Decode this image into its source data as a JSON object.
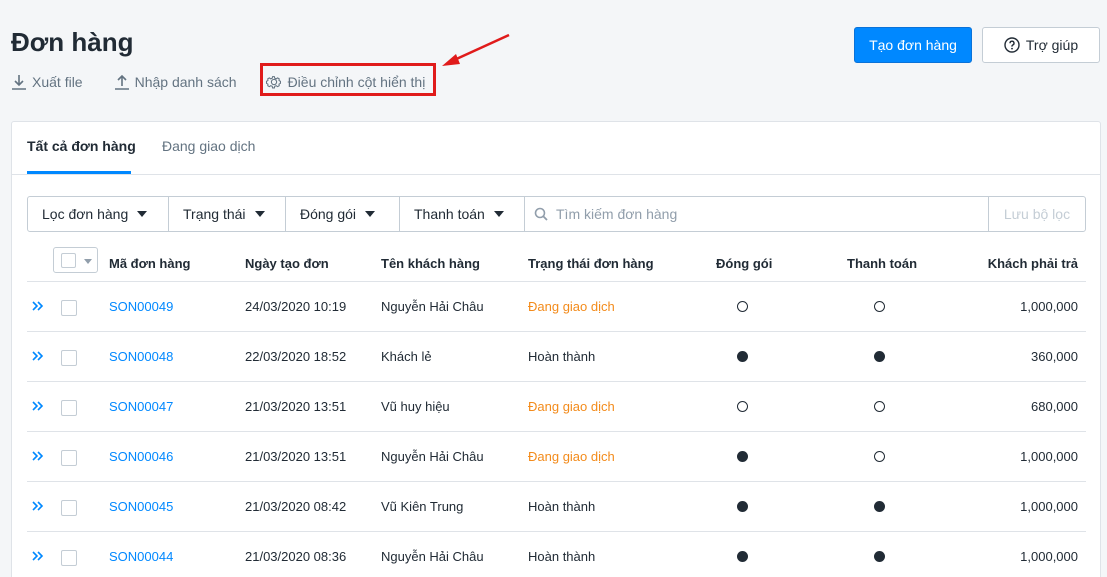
{
  "header": {
    "title": "Đơn hàng",
    "export_label": "Xuất file",
    "import_label": "Nhập danh sách",
    "columns_label": "Điều chỉnh cột hiển thị",
    "create_button": "Tạo đơn hàng",
    "help_button": "Trợ giúp"
  },
  "tabs": [
    {
      "label": "Tất cả đơn hàng",
      "active": true
    },
    {
      "label": "Đang giao dịch",
      "active": false
    }
  ],
  "filters": {
    "items": [
      "Lọc đơn hàng",
      "Trạng thái",
      "Đóng gói",
      "Thanh toán"
    ],
    "search_placeholder": "Tìm kiếm đơn hàng",
    "save_label": "Lưu bộ lọc"
  },
  "table": {
    "headers": {
      "code": "Mã đơn hàng",
      "date": "Ngày tạo đơn",
      "customer": "Tên khách hàng",
      "status": "Trạng thái đơn hàng",
      "packing": "Đóng gói",
      "payment": "Thanh toán",
      "total": "Khách phải trả"
    },
    "rows": [
      {
        "code": "SON00049",
        "date": "24/03/2020 10:19",
        "customer": "Nguyễn Hải Châu",
        "status": "Đang giao dịch",
        "packed": false,
        "paid": false,
        "total": "1,000,000"
      },
      {
        "code": "SON00048",
        "date": "22/03/2020 18:52",
        "customer": "Khách lẻ",
        "status": "Hoàn thành",
        "packed": true,
        "paid": true,
        "total": "360,000"
      },
      {
        "code": "SON00047",
        "date": "21/03/2020 13:51",
        "customer": "Vũ huy hiệu",
        "status": "Đang giao dịch",
        "packed": false,
        "paid": false,
        "total": "680,000"
      },
      {
        "code": "SON00046",
        "date": "21/03/2020 13:51",
        "customer": "Nguyễn Hải Châu",
        "status": "Đang giao dịch",
        "packed": true,
        "paid": false,
        "total": "1,000,000"
      },
      {
        "code": "SON00045",
        "date": "21/03/2020 08:42",
        "customer": "Vũ Kiên Trung",
        "status": "Hoàn thành",
        "packed": true,
        "paid": true,
        "total": "1,000,000"
      },
      {
        "code": "SON00044",
        "date": "21/03/2020 08:36",
        "customer": "Nguyễn Hải Châu",
        "status": "Hoàn thành",
        "packed": true,
        "paid": true,
        "total": "1,000,000"
      }
    ]
  },
  "colors": {
    "primary": "#0088ff",
    "in_progress": "#f38b1b",
    "highlight": "#e01b1b"
  }
}
